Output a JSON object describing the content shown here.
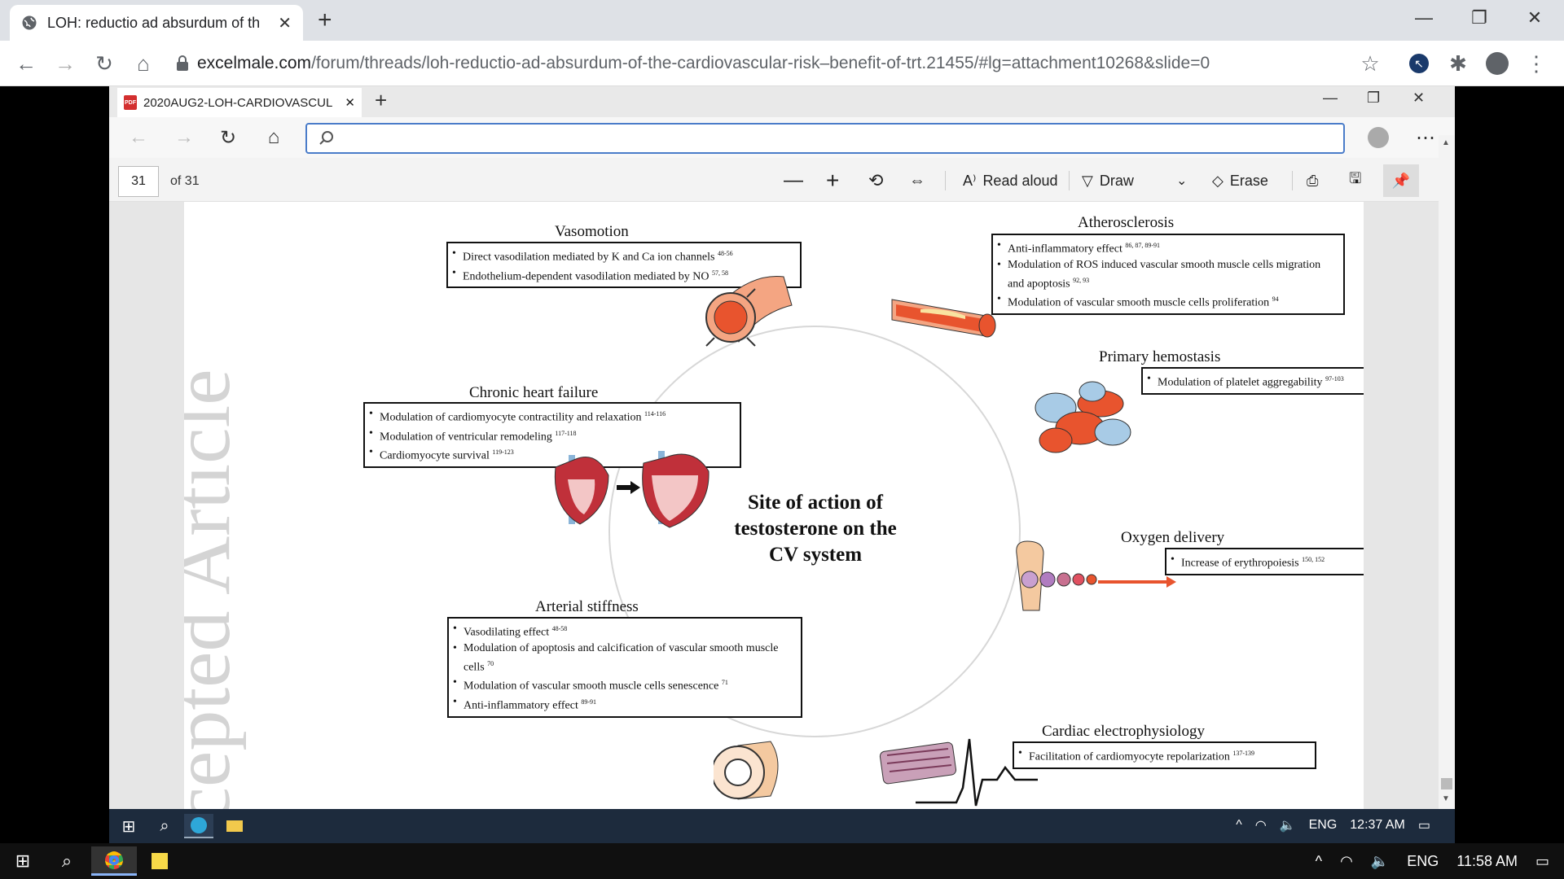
{
  "chrome": {
    "tab_title": "LOH: reductio ad absurdum of th",
    "url_host": "excelmale.com",
    "url_path": "/forum/threads/loh-reductio-ad-absurdum-of-the-cardiovascular-risk–benefit-of-trt.21455/#lg=attachment10268&slide=0"
  },
  "edge": {
    "tab_title": "2020AUG2-LOH-CARDIOVASCUL",
    "pdf_badge": "PDF",
    "page_current": "31",
    "page_total": "of 31",
    "read_aloud": "Read aloud",
    "draw": "Draw",
    "erase": "Erase"
  },
  "figure": {
    "watermark": "Accepted Article",
    "center_title": [
      "Site of action of",
      "testosterone on the",
      "CV system"
    ],
    "vasomotion": {
      "title": "Vasomotion",
      "items": [
        {
          "text": "Direct vasodilation mediated by K and Ca ion channels",
          "ref": "48-56"
        },
        {
          "text": "Endothelium-dependent vasodilation mediated by NO",
          "ref": "57, 58"
        }
      ]
    },
    "atherosclerosis": {
      "title": "Atherosclerosis",
      "items": [
        {
          "text": "Anti-inflammatory effect",
          "ref": "86, 87, 89-91"
        },
        {
          "text": "Modulation of ROS induced vascular smooth muscle cells migration and apoptosis",
          "ref": "92, 93"
        },
        {
          "text": "Modulation of vascular smooth muscle cells proliferation",
          "ref": "94"
        }
      ]
    },
    "hemostasis": {
      "title": "Primary hemostasis",
      "items": [
        {
          "text": "Modulation of platelet aggregability",
          "ref": "97-103"
        }
      ]
    },
    "heart_failure": {
      "title": "Chronic heart failure",
      "items": [
        {
          "text": "Modulation of cardiomyocyte contractility and relaxation",
          "ref": "114-116"
        },
        {
          "text": "Modulation of ventricular remodeling",
          "ref": "117-118"
        },
        {
          "text": "Cardiomyocyte survival",
          "ref": "119-123"
        }
      ]
    },
    "oxygen": {
      "title": "Oxygen delivery",
      "items": [
        {
          "text": "Increase of erythropoiesis",
          "ref": "150, 152"
        }
      ]
    },
    "stiffness": {
      "title": "Arterial stiffness",
      "items": [
        {
          "text": "Vasodilating effect",
          "ref": "48-58"
        },
        {
          "text": "Modulation of apoptosis and calcification of vascular smooth muscle cells",
          "ref": "70"
        },
        {
          "text": "Modulation of vascular smooth muscle cells senescence",
          "ref": "71"
        },
        {
          "text": "Anti-inflammatory effect",
          "ref": "89-91"
        }
      ]
    },
    "electro": {
      "title": "Cardiac electrophysiology",
      "items": [
        {
          "text": "Facilitation of cardiomyocyte repolarization",
          "ref": "137-139"
        }
      ]
    }
  },
  "inner_taskbar": {
    "lang": "ENG",
    "time": "12:37 AM"
  },
  "outer_taskbar": {
    "lang": "ENG",
    "time": "11:58 AM"
  }
}
